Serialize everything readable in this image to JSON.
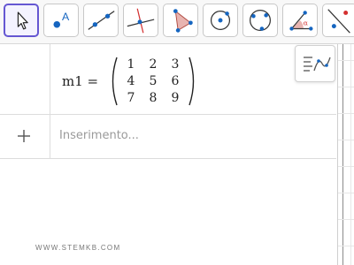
{
  "toolbar": {
    "tools": [
      {
        "name": "move",
        "icon": "cursor-arrow-icon",
        "selected": true
      },
      {
        "name": "point",
        "icon": "point-icon",
        "point_letter": "A"
      },
      {
        "name": "line",
        "icon": "line-through-points-icon"
      },
      {
        "name": "perpendicular-line",
        "icon": "perpendicular-line-icon"
      },
      {
        "name": "polygon",
        "icon": "polygon-icon"
      },
      {
        "name": "circle-center-point",
        "icon": "circle-center-icon"
      },
      {
        "name": "circle-three-points",
        "icon": "circle-three-points-icon"
      },
      {
        "name": "angle",
        "icon": "angle-icon",
        "angle_letter": "α"
      },
      {
        "name": "reflect",
        "icon": "reflect-line-icon"
      }
    ]
  },
  "algebra": {
    "matrix_label": "m1 =",
    "matrix": [
      [
        "1",
        "2",
        "3"
      ],
      [
        "4",
        "5",
        "6"
      ],
      [
        "7",
        "8",
        "9"
      ]
    ],
    "input_placeholder": "Inserimento..."
  },
  "watermark": "WWW.STEMKB.COM",
  "colors": {
    "accent": "#6557d2",
    "point_blue": "#1565c0",
    "accent_red": "#d32f2f",
    "polygon_fill": "#e8b4b0"
  }
}
